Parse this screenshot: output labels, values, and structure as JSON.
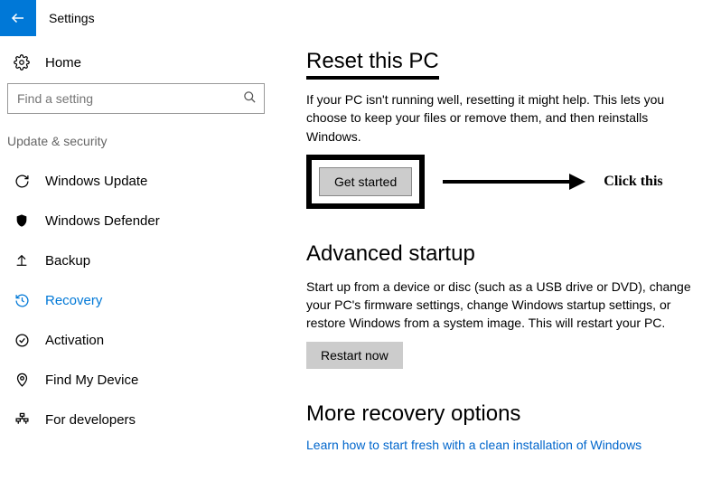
{
  "header": {
    "title": "Settings"
  },
  "search": {
    "placeholder": "Find a setting"
  },
  "home_label": "Home",
  "category": "Update & security",
  "nav": {
    "update": "Windows Update",
    "defender": "Windows Defender",
    "backup": "Backup",
    "recovery": "Recovery",
    "activation": "Activation",
    "findmydevice": "Find My Device",
    "developers": "For developers"
  },
  "reset": {
    "title": "Reset this PC",
    "desc": "If your PC isn't running well, resetting it might help. This lets you choose to keep your files or remove them, and then reinstalls Windows.",
    "button": "Get started"
  },
  "annotation": {
    "text": "Click this"
  },
  "advanced": {
    "title": "Advanced startup",
    "desc": "Start up from a device or disc (such as a USB drive or DVD), change your PC's firmware settings, change Windows startup settings, or restore Windows from a system image. This will restart your PC.",
    "button": "Restart now"
  },
  "more": {
    "title": "More recovery options",
    "link": "Learn how to start fresh with a clean installation of Windows"
  }
}
